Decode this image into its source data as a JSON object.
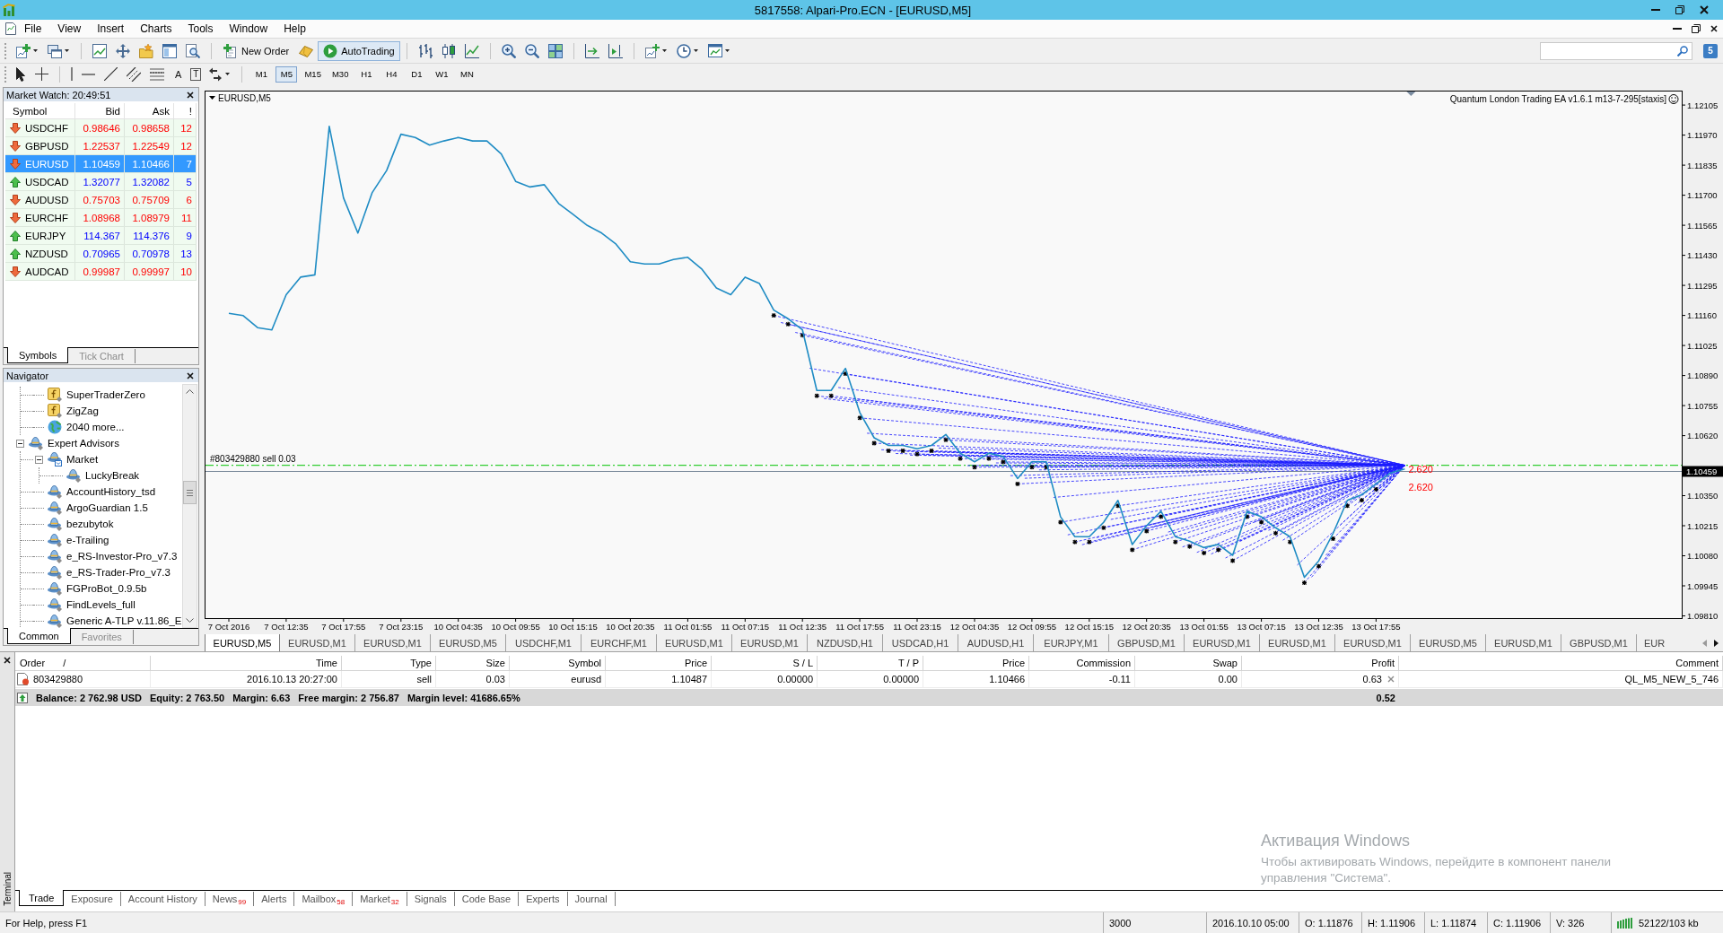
{
  "window": {
    "title": "5817558: Alpari-Pro.ECN - [EURUSD,M5]"
  },
  "menu": [
    "File",
    "View",
    "Insert",
    "Charts",
    "Tools",
    "Window",
    "Help"
  ],
  "toolbar": {
    "new_order": "New Order",
    "autotrading": {
      "label": "AutoTrading",
      "on": true
    },
    "community": "5"
  },
  "drawing_tools": {
    "text_tool": "A",
    "label_tool": "T"
  },
  "periods": [
    {
      "label": "M1",
      "selected": false
    },
    {
      "label": "M5",
      "selected": true
    },
    {
      "label": "M15",
      "selected": false
    },
    {
      "label": "M30",
      "selected": false
    },
    {
      "label": "H1",
      "selected": false
    },
    {
      "label": "H4",
      "selected": false
    },
    {
      "label": "D1",
      "selected": false
    },
    {
      "label": "W1",
      "selected": false
    },
    {
      "label": "MN",
      "selected": false
    }
  ],
  "market_watch": {
    "title": "Market Watch: 20:49:51",
    "columns": [
      "Symbol",
      "Bid",
      "Ask",
      "!"
    ],
    "rows": [
      {
        "kind": "down",
        "symbol": "USDCHF",
        "bid": "0.98646",
        "ask": "0.98658",
        "spread": "12",
        "selected": false
      },
      {
        "kind": "down",
        "symbol": "GBPUSD",
        "bid": "1.22537",
        "ask": "1.22549",
        "spread": "12",
        "selected": false
      },
      {
        "kind": "down",
        "symbol": "EURUSD",
        "bid": "1.10459",
        "ask": "1.10466",
        "spread": "7",
        "selected": true
      },
      {
        "kind": "up",
        "symbol": "USDCAD",
        "bid": "1.32077",
        "ask": "1.32082",
        "spread": "5",
        "selected": false
      },
      {
        "kind": "down",
        "symbol": "AUDUSD",
        "bid": "0.75703",
        "ask": "0.75709",
        "spread": "6",
        "selected": false
      },
      {
        "kind": "down",
        "symbol": "EURCHF",
        "bid": "1.08968",
        "ask": "1.08979",
        "spread": "11",
        "selected": false
      },
      {
        "kind": "up",
        "symbol": "EURJPY",
        "bid": "114.367",
        "ask": "114.376",
        "spread": "9",
        "selected": false
      },
      {
        "kind": "up",
        "symbol": "NZDUSD",
        "bid": "0.70965",
        "ask": "0.70978",
        "spread": "13",
        "selected": false
      },
      {
        "kind": "down",
        "symbol": "AUDCAD",
        "bid": "0.99987",
        "ask": "0.99997",
        "spread": "10",
        "selected": false
      }
    ],
    "tabs": [
      {
        "label": "Symbols",
        "selected": true
      },
      {
        "label": "Tick Chart",
        "selected": false
      }
    ]
  },
  "navigator": {
    "title": "Navigator",
    "tree": [
      {
        "children": [
          {
            "kind": "indicator",
            "label": "SuperTraderZero"
          },
          {
            "kind": "indicator",
            "label": "ZigZag"
          },
          {
            "kind": "more",
            "label": "2040 more..."
          }
        ]
      },
      {
        "kind": "expert",
        "label": "Expert Advisors",
        "expanded": true,
        "children": [
          {
            "kind": "market",
            "label": "Market",
            "expanded": true,
            "children": [
              {
                "kind": "expert",
                "label": "LuckyBreak"
              }
            ]
          },
          {
            "kind": "expert",
            "label": "AccountHistory_tsd"
          },
          {
            "kind": "expert",
            "label": "ArgoGuardian 1.5"
          },
          {
            "kind": "expert",
            "label": "bezubytok"
          },
          {
            "kind": "expert",
            "label": "e-Trailing"
          },
          {
            "kind": "expert",
            "label": "e_RS-Investor-Pro_v7.3"
          },
          {
            "kind": "expert",
            "label": "e_RS-Trader-Pro_v7.3"
          },
          {
            "kind": "expert",
            "label": "FGProBot_0.9.5b"
          },
          {
            "kind": "expert",
            "label": "FindLevels_full"
          },
          {
            "kind": "expert",
            "label": "Generic A-TLP v.11.86_E"
          }
        ]
      }
    ],
    "tabs": [
      {
        "label": "Common",
        "selected": true
      },
      {
        "label": "Favorites",
        "selected": false
      }
    ]
  },
  "chart": {
    "symbol_label": "EURUSD,M5",
    "ea_label": "Quantum London Trading EA v1.6.1 m13-7-295[staxis]",
    "chart_data": [
      {
        "type": "line",
        "color": "#1f8cc4",
        "categories": [
          "7 Oct 2016",
          null,
          null,
          null,
          "7 Oct 12:35",
          null,
          null,
          null,
          "7 Oct 17:55",
          null,
          null,
          null,
          "7 Oct 23:15",
          null,
          null,
          null,
          "10 Oct 04:35",
          null,
          null,
          null,
          "10 Oct 09:55",
          null,
          null,
          null,
          "10 Oct 15:15",
          null,
          null,
          null,
          "10 Oct 20:35",
          null,
          null,
          null,
          "11 Oct 01:55",
          null,
          null,
          null,
          "11 Oct 07:15",
          null,
          null,
          null,
          "11 Oct 12:35",
          null,
          null,
          null,
          "11 Oct 17:55",
          null,
          null,
          null,
          "11 Oct 23:15",
          null,
          null,
          null,
          "12 Oct 04:35",
          null,
          null,
          null,
          "12 Oct 09:55",
          null,
          null,
          null,
          "12 Oct 15:15",
          null,
          null,
          null,
          "12 Oct 20:35",
          null,
          null,
          null,
          "13 Oct 01:55",
          null,
          null,
          null,
          "13 Oct 07:15",
          null,
          null,
          null,
          "13 Oct 12:35",
          null,
          null,
          null,
          "13 Oct 17:55",
          null,
          null
        ],
        "values": [
          1.11169,
          1.11159,
          1.11105,
          1.11095,
          1.11253,
          1.11332,
          1.11342,
          1.12009,
          1.11688,
          1.1153,
          1.11712,
          1.11811,
          1.11974,
          1.11959,
          1.11925,
          1.11944,
          1.11959,
          1.11944,
          1.11944,
          1.11885,
          1.11762,
          1.11737,
          1.11747,
          1.11663,
          1.11614,
          1.11564,
          1.1153,
          1.1148,
          1.11401,
          1.11391,
          1.11391,
          1.11411,
          1.11421,
          1.11367,
          1.11283,
          1.11253,
          1.11332,
          1.11303,
          1.11184,
          1.11145,
          1.11095,
          1.10823,
          1.10823,
          1.10922,
          1.10724,
          1.1061,
          1.10576,
          1.10576,
          1.10561,
          1.10576,
          1.10625,
          1.10541,
          1.10502,
          1.10541,
          1.10526,
          1.10427,
          1.10502,
          1.10502,
          1.10255,
          1.10166,
          1.10166,
          1.1023,
          1.10329,
          1.10131,
          1.10215,
          1.1028,
          1.10166,
          1.10146,
          1.10117,
          1.10131,
          1.10082,
          1.1028,
          1.10255,
          1.10206,
          1.10166,
          1.09983,
          1.10057,
          1.10181,
          1.10329,
          1.10354,
          1.10403,
          1.10452,
          1.1047
        ],
        "ylim": [
          1.098,
          1.1217
        ],
        "yticks": [
          1.12105,
          {
            "value": 1.1197,
            "label": "1.11970"
          },
          1.11835,
          {
            "value": 1.117,
            "label": "1.11700"
          },
          1.11565,
          {
            "value": 1.1143,
            "label": "1.11430"
          },
          1.11295,
          {
            "value": 1.1116,
            "label": "1.11160"
          },
          1.11025,
          {
            "value": 1.1089,
            "label": "1.10890"
          },
          1.10755,
          {
            "value": 1.1062,
            "label": "1.10620"
          },
          {
            "value": 1.1035,
            "label": "1.10350"
          },
          1.10215,
          {
            "value": 1.1008,
            "label": "1.10080"
          },
          1.09945,
          {
            "value": 1.0981,
            "label": "1.09810"
          }
        ],
        "ref_lines": [
          {
            "axis": "y",
            "value": 1.10487,
            "label": "#803429880 sell 0.03",
            "color": "#32cd32",
            "line_style": "dashdot"
          },
          {
            "axis": "y",
            "value": 1.10459,
            "label": "1.10459",
            "color": "#778899",
            "line_style": "solid"
          }
        ],
        "annotations": [
          "2.620",
          "2.620"
        ]
      }
    ]
  },
  "chart_tabs": [
    {
      "label": "EURUSD,M5",
      "selected": true
    },
    {
      "label": "EURUSD,M1",
      "selected": false
    },
    {
      "label": "EURUSD,M1",
      "selected": false
    },
    {
      "label": "EURUSD,M5",
      "selected": false
    },
    {
      "label": "USDCHF,M1",
      "selected": false
    },
    {
      "label": "EURCHF,M1",
      "selected": false
    },
    {
      "label": "EURUSD,M1",
      "selected": false
    },
    {
      "label": "EURUSD,M1",
      "selected": false
    },
    {
      "label": "NZDUSD,H1",
      "selected": false
    },
    {
      "label": "USDCAD,H1",
      "selected": false
    },
    {
      "label": "AUDUSD,H1",
      "selected": false
    },
    {
      "label": "EURJPY,M1",
      "selected": false
    },
    {
      "label": "GBPUSD,M1",
      "selected": false
    },
    {
      "label": "EURUSD,M1",
      "selected": false
    },
    {
      "label": "EURUSD,M1",
      "selected": false
    },
    {
      "label": "EURUSD,M1",
      "selected": false
    },
    {
      "label": "EURUSD,M5",
      "selected": false
    },
    {
      "label": "EURUSD,M1",
      "selected": false
    },
    {
      "label": "GBPUSD,M1",
      "selected": false
    },
    {
      "label": "EUR",
      "selected": false
    }
  ],
  "terminal": {
    "title": "Terminal",
    "columns": [
      {
        "label": "Order",
        "sort_mark": "/"
      },
      {
        "label": "Time"
      },
      {
        "label": "Type"
      },
      {
        "label": "Size"
      },
      {
        "label": "Symbol"
      },
      {
        "label": "Price"
      },
      {
        "label": "S / L"
      },
      {
        "label": "T / P"
      },
      {
        "label": "Price"
      },
      {
        "label": "Commission"
      },
      {
        "label": "Swap"
      },
      {
        "label": "Profit"
      },
      {
        "label": "Comment"
      }
    ],
    "orders": [
      {
        "kind": "sell",
        "cells": [
          "803429880",
          "2016.10.13 20:27:00",
          "sell",
          "0.03",
          "eurusd",
          "1.10487",
          "0.00000",
          "0.00000",
          "1.10466",
          "-0.11",
          "0.00",
          "0.63",
          "QL_M5_NEW_5_746"
        ]
      }
    ],
    "summary": {
      "parts": [
        "Balance: 2 762.98 USD",
        "Equity: 2 763.50",
        "Margin: 6.63",
        "Free margin: 2 756.87",
        "Margin level: 41686.65%"
      ],
      "profit": "0.52"
    },
    "tabs": [
      {
        "label": "Trade",
        "selected": true
      },
      {
        "label": "Exposure",
        "selected": false
      },
      {
        "label": "Account History",
        "selected": false
      },
      {
        "label": "News",
        "badge": "99",
        "selected": false
      },
      {
        "label": "Alerts",
        "selected": false
      },
      {
        "label": "Mailbox",
        "badge": "58",
        "selected": false
      },
      {
        "label": "Market",
        "badge": "32",
        "selected": false
      },
      {
        "label": "Signals",
        "selected": false
      },
      {
        "label": "Code Base",
        "selected": false
      },
      {
        "label": "Experts",
        "selected": false
      },
      {
        "label": "Journal",
        "selected": false
      }
    ]
  },
  "activation_notice": {
    "title": "Активация Windows",
    "text": "Чтобы активировать Windows, перейдите в компонент панели управления \"Система\"."
  },
  "status_bar": {
    "help": "For Help, press F1",
    "profile": "3000",
    "date": "2016.10.10 05:00",
    "open": "O: 1.11876",
    "high": "H: 1.11906",
    "low": "L: 1.11874",
    "close": "C: 1.11906",
    "volume": "V: 326",
    "traffic": "52122/103 kb"
  }
}
